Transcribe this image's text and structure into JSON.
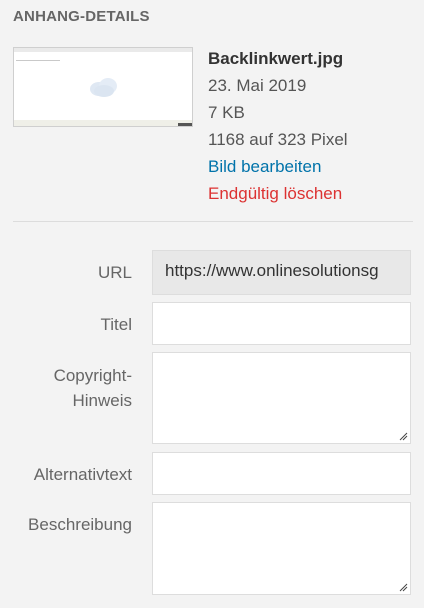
{
  "header": {
    "title": "ANHANG-DETAILS"
  },
  "attachment": {
    "filename": "Backlinkwert.jpg",
    "date": "23. Mai 2019",
    "size": "7 KB",
    "dimensions": "1168 auf 323 Pixel",
    "edit_link": "Bild bearbeiten",
    "delete_link": "Endgültig löschen"
  },
  "fields": {
    "url": {
      "label": "URL",
      "value": "https://www.onlinesolutionsg"
    },
    "title": {
      "label": "Titel",
      "value": ""
    },
    "copyright": {
      "label_line1": "Copyright-",
      "label_line2": "Hinweis",
      "value": ""
    },
    "alt": {
      "label": "Alternativtext",
      "value": ""
    },
    "description": {
      "label": "Beschreibung",
      "value": ""
    }
  },
  "colors": {
    "link": "#0073aa",
    "delete": "#dc3232",
    "background": "#f3f3f3"
  }
}
